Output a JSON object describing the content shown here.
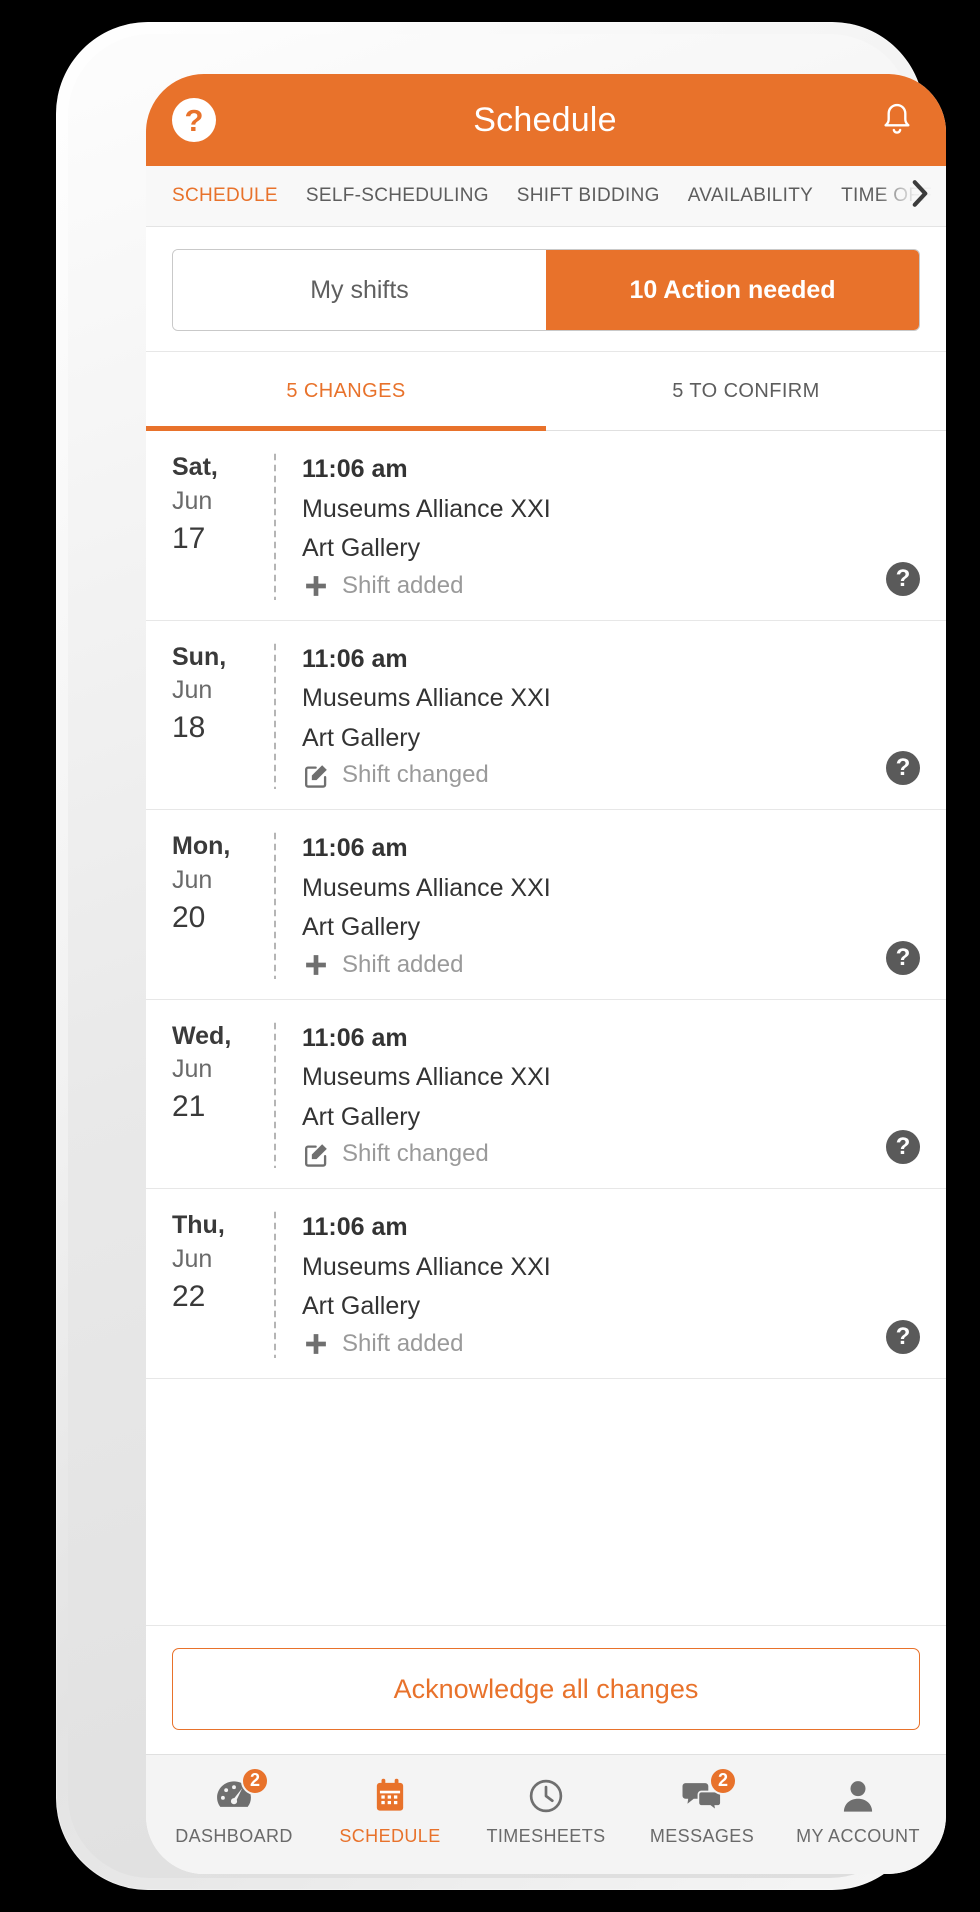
{
  "colors": {
    "accent": "#e8722b",
    "text_primary": "#333333",
    "text_muted": "#9a9a9a",
    "screen_bg": "#ffffff"
  },
  "header": {
    "help_icon": "question-mark-circle-icon",
    "help_label": "?",
    "title": "Schedule",
    "bell_icon": "notification-bell-icon"
  },
  "top_tabs": {
    "chevron_icon": "chevron-right-icon",
    "items": [
      {
        "label": "SCHEDULE",
        "active": true
      },
      {
        "label": "SELF-SCHEDULING",
        "active": false
      },
      {
        "label": "SHIFT BIDDING",
        "active": false
      },
      {
        "label": "AVAILABILITY",
        "active": false
      },
      {
        "label": "TIME OFF",
        "active": false
      }
    ]
  },
  "segment": {
    "my_shifts_label": "My shifts",
    "action_needed_label": "10 Action needed",
    "action_needed_count": 10,
    "selected": "action_needed"
  },
  "sub_tabs": {
    "changes_label": "5 CHANGES",
    "confirm_label": "5 TO CONFIRM",
    "changes_count": 5,
    "confirm_count": 5,
    "selected": "changes"
  },
  "changes": [
    {
      "dow": "Sat,",
      "month": "Jun",
      "day": "17",
      "time": "11:06 am",
      "organisation": "Museums Alliance XXI",
      "location": "Art Gallery",
      "status": "Shift added",
      "status_icon": "plus-icon",
      "help_label": "?"
    },
    {
      "dow": "Sun,",
      "month": "Jun",
      "day": "18",
      "time": "11:06 am",
      "organisation": "Museums Alliance XXI",
      "location": "Art Gallery",
      "status": "Shift changed",
      "status_icon": "edit-pencil-icon",
      "help_label": "?"
    },
    {
      "dow": "Mon,",
      "month": "Jun",
      "day": "20",
      "time": "11:06 am",
      "organisation": "Museums Alliance XXI",
      "location": "Art Gallery",
      "status": "Shift added",
      "status_icon": "plus-icon",
      "help_label": "?"
    },
    {
      "dow": "Wed,",
      "month": "Jun",
      "day": "21",
      "time": "11:06 am",
      "organisation": "Museums Alliance XXI",
      "location": "Art Gallery",
      "status": "Shift changed",
      "status_icon": "edit-pencil-icon",
      "help_label": "?"
    },
    {
      "dow": "Thu,",
      "month": "Jun",
      "day": "22",
      "time": "11:06 am",
      "organisation": "Museums Alliance XXI",
      "location": "Art Gallery",
      "status": "Shift added",
      "status_icon": "plus-icon",
      "help_label": "?"
    }
  ],
  "footer": {
    "acknowledge_label": "Acknowledge all changes"
  },
  "bottom_nav": [
    {
      "label": "DASHBOARD",
      "icon": "gauge-icon",
      "badge": "2",
      "active": false
    },
    {
      "label": "SCHEDULE",
      "icon": "calendar-icon",
      "badge": null,
      "active": true
    },
    {
      "label": "TIMESHEETS",
      "icon": "clock-icon",
      "badge": null,
      "active": false
    },
    {
      "label": "MESSAGES",
      "icon": "chat-bubbles-icon",
      "badge": "2",
      "active": false
    },
    {
      "label": "MY ACCOUNT",
      "icon": "person-icon",
      "badge": null,
      "active": false
    }
  ]
}
